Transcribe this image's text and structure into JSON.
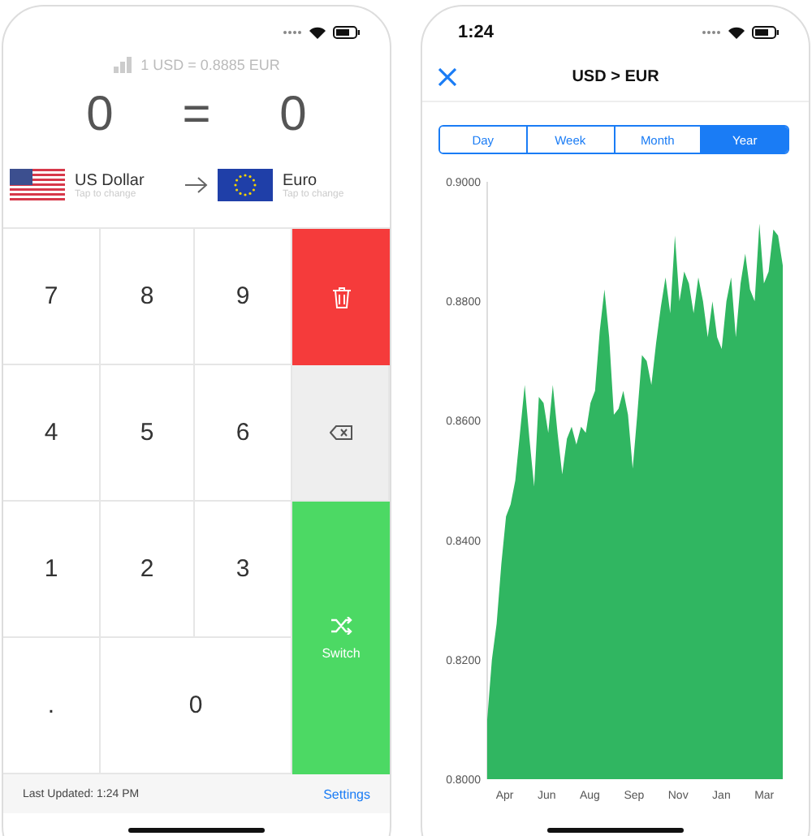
{
  "left_phone": {
    "rate": "1 USD = 0.8885 EUR",
    "amount_from": "0",
    "equals": "=",
    "amount_to": "0",
    "from_currency": {
      "kind": "us",
      "name": "US Dollar",
      "hint": "Tap to change"
    },
    "to_currency": {
      "kind": "eu",
      "name": "Euro",
      "hint": "Tap to change"
    },
    "keys": [
      {
        "kind": "digit",
        "label": "7"
      },
      {
        "kind": "digit",
        "label": "8"
      },
      {
        "kind": "digit",
        "label": "9"
      },
      {
        "kind": "clear"
      },
      {
        "kind": "digit",
        "label": "4"
      },
      {
        "kind": "digit",
        "label": "5"
      },
      {
        "kind": "digit",
        "label": "6"
      },
      {
        "kind": "backspace"
      },
      {
        "kind": "digit",
        "label": "1"
      },
      {
        "kind": "digit",
        "label": "2"
      },
      {
        "kind": "digit",
        "label": "3"
      },
      {
        "kind": "switch",
        "label": "Switch"
      },
      {
        "kind": "digit",
        "label": "."
      },
      {
        "kind": "wide",
        "label": "0"
      }
    ],
    "footer": {
      "last_updated": "Last Updated: 1:24 PM",
      "settings": "Settings"
    }
  },
  "right_phone": {
    "time": "1:24",
    "title": "USD > EUR",
    "periods": [
      {
        "label": "Day",
        "selected": false
      },
      {
        "label": "Week",
        "selected": false
      },
      {
        "label": "Month",
        "selected": false
      },
      {
        "label": "Year",
        "selected": true
      }
    ],
    "chart_data": {
      "type": "area",
      "ylim": [
        0.8,
        0.9
      ],
      "yticks": [
        {
          "value": 0.8,
          "label": "0.8000"
        },
        {
          "value": 0.82,
          "label": "0.8200"
        },
        {
          "value": 0.84,
          "label": "0.8400"
        },
        {
          "value": 0.86,
          "label": "0.8600"
        },
        {
          "value": 0.88,
          "label": "0.8800"
        },
        {
          "value": 0.9,
          "label": "0.9000"
        }
      ],
      "series": [
        {
          "color": "#30b661",
          "values": [
            0.81,
            0.82,
            0.826,
            0.836,
            0.844,
            0.846,
            0.85,
            0.858,
            0.866,
            0.857,
            0.849,
            0.864,
            0.863,
            0.858,
            0.866,
            0.858,
            0.851,
            0.857,
            0.859,
            0.856,
            0.859,
            0.858,
            0.863,
            0.865,
            0.875,
            0.882,
            0.874,
            0.861,
            0.862,
            0.865,
            0.861,
            0.852,
            0.861,
            0.871,
            0.87,
            0.866,
            0.873,
            0.879,
            0.884,
            0.878,
            0.891,
            0.88,
            0.885,
            0.883,
            0.878,
            0.884,
            0.88,
            0.874,
            0.88,
            0.874,
            0.872,
            0.88,
            0.884,
            0.874,
            0.883,
            0.888,
            0.882,
            0.88,
            0.893,
            0.883,
            0.885,
            0.892,
            0.891,
            0.886
          ]
        }
      ]
    },
    "month_labels": [
      "Apr",
      "Jun",
      "Aug",
      "Sep",
      "Nov",
      "Jan",
      "Mar"
    ]
  }
}
